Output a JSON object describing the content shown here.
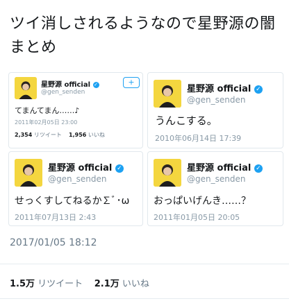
{
  "headline": "ツイ消しされるようなので星野源の闇まとめ",
  "accent_color": "#1da1f2",
  "tweets": [
    {
      "name": "星野源 official",
      "handle": "@gen_senden",
      "text": "てまんてまん……♪",
      "date": "2011年02月05日 23:00",
      "retweets": "2,354",
      "retweets_label": "リツイート",
      "likes": "1,956",
      "likes_label": "いいね",
      "follow_icon": "follow-user-icon"
    },
    {
      "name": "星野源 official",
      "handle": "@gen_senden",
      "text": "うんこする。",
      "date": "2010年06月14日 17:39"
    },
    {
      "name": "星野源 official",
      "handle": "@gen_senden",
      "text": "せっくすしてねるか∑ﾞ･ω",
      "date": "2011年07月13日 2:43"
    },
    {
      "name": "星野源 official",
      "handle": "@gen_senden",
      "text": "おっぱいげんき……？",
      "date": "2011年01月05日 20:05"
    }
  ],
  "post_timestamp": "2017/01/05 18:12",
  "post_stats": {
    "retweets": "1.5万",
    "retweets_label": "リツイート",
    "likes": "2.1万",
    "likes_label": "いいね"
  }
}
